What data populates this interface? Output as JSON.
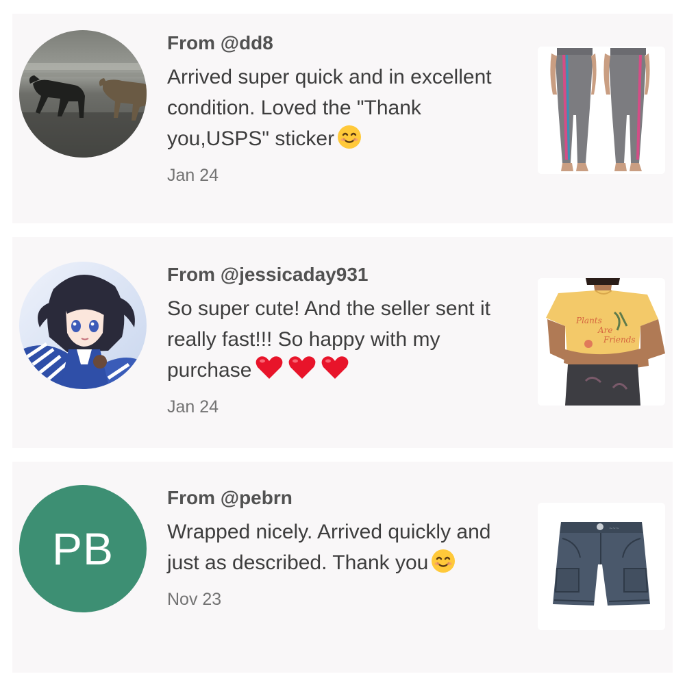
{
  "reviews": [
    {
      "from": "From @dd8",
      "message": "Arrived super quick and in excellent condition. Loved the \"Thank you,USPS\" sticker",
      "emoji": "smiling-face-icon",
      "date": "Jan 24",
      "avatar": "dogs-on-beach-photo",
      "product": "striped-leggings-photo"
    },
    {
      "from": "From @jessicaday931",
      "message": "So super cute! And the seller sent it really fast!!! So happy with my purchase",
      "emoji": "three-red-hearts-icon",
      "date": "Jan 24",
      "avatar": "anime-girl-illustration",
      "product": "yellow-tee-photo"
    },
    {
      "from": "From @pebrn",
      "message": "Wrapped nicely. Arrived quickly and just as described. Thank you",
      "emoji": "smiling-face-icon",
      "date": "Nov 23",
      "avatar_initials": "PB",
      "product": "navy-shorts-photo"
    }
  ],
  "colors": {
    "card_background": "#f9f7f8",
    "initials_avatar": "#3d8f73",
    "heart": "#e8142a",
    "smiley": "#ffc93a"
  }
}
